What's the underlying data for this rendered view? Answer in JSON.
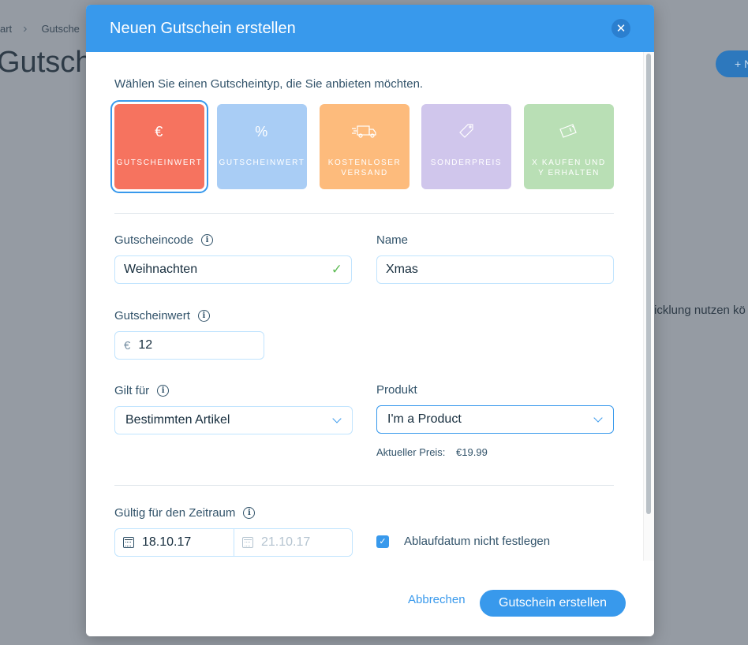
{
  "background": {
    "breadcrumb": [
      "art",
      "Gutsche"
    ],
    "title": "Gutsche",
    "add_button": "+ N",
    "text": "ricklung nutzen kö"
  },
  "modal": {
    "title": "Neuen Gutschein erstellen",
    "close_icon": "close-icon",
    "type_prompt": "Wählen Sie einen Gutscheintyp, die Sie anbieten möchten.",
    "types": [
      {
        "label": "GUTSCHEINWERT",
        "icon": "€",
        "color": "#f6735f",
        "selected": true
      },
      {
        "label": "GUTSCHEINWERT",
        "icon": "%",
        "color": "#a9cdf5",
        "selected": false
      },
      {
        "label": "KOSTENLOSER\nVERSAND",
        "icon": "truck-icon",
        "color": "#fdbb7c",
        "selected": false
      },
      {
        "label": "SONDERPREIS",
        "icon": "tag-icon",
        "color": "#d0c6ec",
        "selected": false
      },
      {
        "label": "X KAUFEN UND\nY ERHALTEN",
        "icon": "gift-card-icon",
        "color": "#b9dfb5",
        "selected": false
      }
    ],
    "code": {
      "label": "Gutscheincode",
      "value": "Weihnachten"
    },
    "name": {
      "label": "Name",
      "value": "Xmas"
    },
    "value": {
      "label": "Gutscheinwert",
      "currency": "€",
      "value": "12"
    },
    "applies_to": {
      "label": "Gilt für",
      "value": "Bestimmten Artikel"
    },
    "product": {
      "label": "Produkt",
      "value": "I'm a Product",
      "price_label": "Aktueller Preis:",
      "price": "€19.99"
    },
    "validity": {
      "label": "Gültig für den Zeitraum",
      "start": "18.10.17",
      "end": "21.10.17"
    },
    "no_expiry": {
      "label": "Ablaufdatum nicht festlegen",
      "checked": true
    },
    "footer": {
      "cancel": "Abbrechen",
      "create": "Gutschein erstellen"
    }
  }
}
